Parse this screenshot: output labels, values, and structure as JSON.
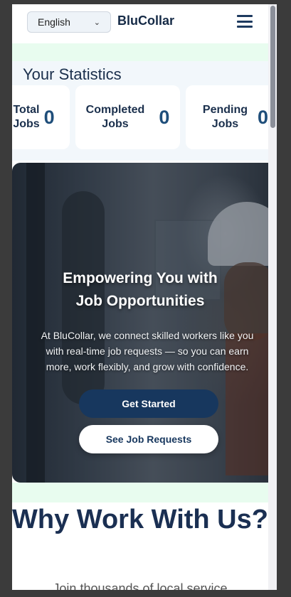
{
  "header": {
    "language": "English",
    "brand": "BluCollar"
  },
  "stats": {
    "title": "Your Statistics",
    "cards": [
      {
        "label": "Total\nJobs",
        "value": "0"
      },
      {
        "label": "Completed\nJobs",
        "value": "0"
      },
      {
        "label": "Pending\nJobs",
        "value": "0"
      }
    ]
  },
  "hero": {
    "title_line1": "Empowering You with",
    "title_line2": "Job Opportunities",
    "subtitle": "At BluCollar, we connect skilled workers like you with real-time job requests — so you can earn more, work flexibly, and grow with confidence.",
    "primary_button": "Get Started",
    "secondary_button": "See Job Requests"
  },
  "why": {
    "title": "Why Work With Us?",
    "subtitle": "Join thousands of local service"
  },
  "colors": {
    "brand_navy": "#17375e",
    "mint": "#e8fcef"
  }
}
